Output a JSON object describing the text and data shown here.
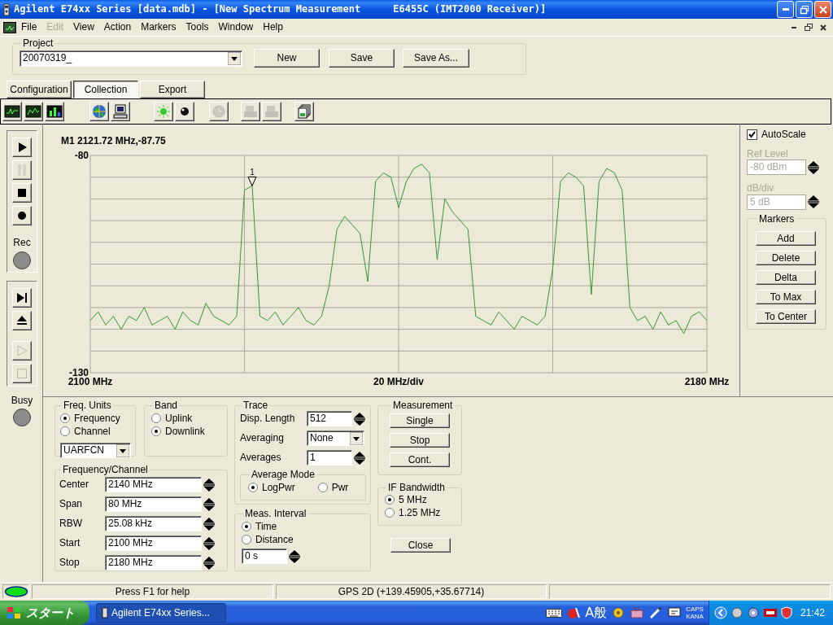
{
  "window": {
    "title": "Agilent E74xx Series [data.mdb] - [New Spectrum Measurement",
    "instrument": "E6455C (IMT2000 Receiver)]"
  },
  "menu": [
    {
      "label": "File",
      "disabled": false
    },
    {
      "label": "Edit",
      "disabled": true
    },
    {
      "label": "View",
      "disabled": false
    },
    {
      "label": "Action",
      "disabled": false
    },
    {
      "label": "Markers",
      "disabled": false
    },
    {
      "label": "Tools",
      "disabled": false
    },
    {
      "label": "Window",
      "disabled": false
    },
    {
      "label": "Help",
      "disabled": false
    }
  ],
  "project": {
    "label": "Project",
    "value": "20070319_",
    "buttons": [
      "New",
      "Save",
      "Save As..."
    ]
  },
  "tabs": [
    {
      "label": "Configuration",
      "selected": false
    },
    {
      "label": "Collection",
      "selected": true
    },
    {
      "label": "Export",
      "selected": false
    }
  ],
  "toolbar": [
    {
      "disabled": false
    },
    {
      "disabled": false
    },
    {
      "disabled": false
    },
    {
      "disabled": false
    },
    {
      "disabled": false
    },
    {
      "disabled": false
    },
    {
      "disabled": false
    },
    {
      "disabled": true
    },
    {
      "disabled": true
    },
    {
      "disabled": true
    },
    {
      "disabled": false
    }
  ],
  "transport": [
    {
      "disabled": false
    },
    {
      "disabled": true
    },
    {
      "disabled": false
    },
    {
      "disabled": false
    }
  ],
  "rec_lamp": {
    "label": "Rec",
    "on": false
  },
  "transport2": [
    {
      "disabled": false
    },
    {
      "disabled": false
    },
    {
      "disabled": true
    },
    {
      "disabled": true
    }
  ],
  "busy_lamp": {
    "label": "Busy",
    "on": false
  },
  "plot": {
    "chart_data": {
      "type": "line",
      "title": "M1 2121.72 MHz,-87.75",
      "xlabel": "20 MHz/div",
      "xlim": [
        2100,
        2180
      ],
      "ylim": [
        -130,
        -80
      ],
      "xticks": [
        {
          "value": 2100,
          "label": "2100 MHz"
        },
        {
          "value": 2180,
          "label": "2180 MHz"
        }
      ],
      "yticks": [
        -130,
        -80
      ],
      "x": [
        2100,
        2101,
        2102,
        2103,
        2104,
        2105,
        2106,
        2107,
        2108,
        2109,
        2110,
        2111,
        2112,
        2113,
        2114,
        2115,
        2116,
        2117,
        2118,
        2119,
        2120,
        2121,
        2122,
        2123,
        2124,
        2125,
        2126,
        2127,
        2128,
        2129,
        2130,
        2131,
        2132,
        2133,
        2134,
        2135,
        2136,
        2137,
        2138,
        2139,
        2140,
        2141,
        2142,
        2143,
        2144,
        2145,
        2146,
        2147,
        2148,
        2149,
        2150,
        2151,
        2152,
        2153,
        2154,
        2155,
        2156,
        2157,
        2158,
        2159,
        2160,
        2161,
        2162,
        2163,
        2164,
        2165,
        2166,
        2167,
        2168,
        2169,
        2170,
        2171,
        2172,
        2173,
        2174,
        2175,
        2176,
        2177,
        2178,
        2179,
        2180
      ],
      "series": [
        {
          "color": "#339933",
          "values": [
            -118,
            -116,
            -119,
            -117,
            -120,
            -117,
            -118,
            -115,
            -119,
            -118,
            -117,
            -120,
            -116,
            -118,
            -119,
            -114,
            -117,
            -118,
            -119,
            -117,
            -88,
            -87,
            -117,
            -118,
            -116,
            -119,
            -117,
            -115,
            -118,
            -119,
            -117,
            -110,
            -97,
            -94,
            -96,
            -98,
            -109,
            -86,
            -84,
            -85,
            -92,
            -86,
            -83,
            -82,
            -84,
            -104,
            -90,
            -93,
            -95,
            -97,
            -117,
            -118,
            -119,
            -116,
            -118,
            -120,
            -117,
            -118,
            -119,
            -117,
            -106,
            -86,
            -84,
            -85,
            -87,
            -112,
            -86,
            -83,
            -84,
            -88,
            -115,
            -118,
            -117,
            -120,
            -116,
            -119,
            -118,
            -121,
            -117,
            -116,
            -118
          ]
        }
      ],
      "annotations": [
        {
          "x": 2121,
          "y": -87,
          "text": "1"
        }
      ]
    }
  },
  "display": {
    "autoscale": {
      "label": "AutoScale",
      "checked": true
    },
    "ref_level": {
      "label": "Ref Level",
      "value": "-80 dBm",
      "disabled": true
    },
    "db_per_div": {
      "label": "dB/div",
      "value": "5 dB",
      "disabled": true
    },
    "markers": {
      "title": "Markers",
      "buttons": [
        "Add",
        "Delete",
        "Delta",
        "To Max",
        "To Center"
      ]
    }
  },
  "freq_units": {
    "title": "Freq. Units",
    "options": [
      {
        "label": "Frequency",
        "selected": true
      },
      {
        "label": "Channel",
        "selected": false
      }
    ],
    "channel_type": "UARFCN"
  },
  "band": {
    "title": "Band",
    "options": [
      {
        "label": "Uplink",
        "selected": false
      },
      {
        "label": "Downlink",
        "selected": true
      }
    ]
  },
  "frequency_channel": {
    "title": "Frequency/Channel",
    "fields": [
      {
        "label": "Center",
        "value": "2140 MHz"
      },
      {
        "label": "Span",
        "value": "80 MHz"
      },
      {
        "label": "RBW",
        "value": "25.08 kHz"
      },
      {
        "label": "Start",
        "value": "2100 MHz"
      },
      {
        "label": "Stop",
        "value": "2180 MHz"
      }
    ]
  },
  "trace": {
    "title": "Trace",
    "disp_length": {
      "label": "Disp. Length",
      "value": "512"
    },
    "averaging": {
      "label": "Averaging",
      "value": "None"
    },
    "averages": {
      "label": "Averages",
      "value": "1"
    },
    "average_mode": {
      "title": "Average Mode",
      "options": [
        {
          "label": "LogPwr",
          "selected": true
        },
        {
          "label": "Pwr",
          "selected": false
        }
      ]
    }
  },
  "meas_interval": {
    "title": "Meas. Interval",
    "options": [
      {
        "label": "Time",
        "selected": true
      },
      {
        "label": "Distance",
        "selected": false
      }
    ],
    "value": "0 s"
  },
  "measurement": {
    "title": "Measurement",
    "buttons": [
      "Single",
      "Stop",
      "Cont."
    ]
  },
  "if_bandwidth": {
    "title": "IF Bandwidth",
    "options": [
      {
        "label": "5 MHz",
        "selected": true
      },
      {
        "label": "1.25 MHz",
        "selected": false
      }
    ]
  },
  "close_button": "Close",
  "status_bar": {
    "connected": true,
    "help": "Press F1 for help",
    "gps": "GPS 2D (+139.45905,+35.67714)"
  },
  "taskbar": {
    "start": "スタート",
    "window": "Agilent E74xx Series...",
    "ime": "A般",
    "caps": "CAPS",
    "kana": "KANA",
    "clock": "21:42"
  }
}
